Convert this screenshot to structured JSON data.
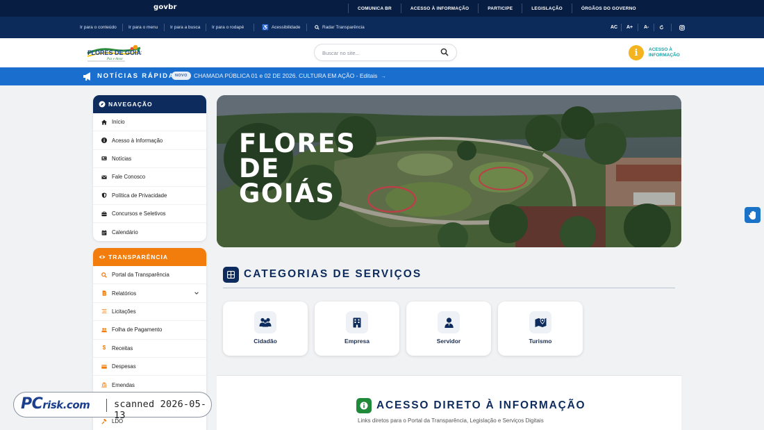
{
  "govbar": {
    "logo": "govbr",
    "links": [
      "COMUNICA BR",
      "ACESSO À INFORMAÇÃO",
      "PARTICIPE",
      "LEGISLAÇÃO",
      "ÓRGÃOS DO GOVERNO"
    ]
  },
  "accessibility": {
    "skip_content": "Ir para o conteúdo",
    "skip_menu": "Ir para o menu",
    "skip_search": "Ir para a busca",
    "skip_footer": "Ir para o rodapé",
    "accessibility": "Acessibilidade",
    "radar": "Radar Transparência",
    "contrast": "AC",
    "font_increase": "A+",
    "font_decrease": "A-",
    "reset_icon": "reset-icon",
    "instagram_icon": "instagram-icon"
  },
  "header": {
    "logo_text": "FLORES DE GOIÁS - GO",
    "logo_tagline": "Paz e Amor",
    "search_placeholder": "Buscar no site...",
    "acesso_label_1": "ACESSO À",
    "acesso_label_2": "INFORMAÇÃO",
    "acesso_badge": "i"
  },
  "newsbar": {
    "label": "NOTÍCIAS RÁPIDAS",
    "separator": "-",
    "badge": "NOVO",
    "headline": "CHAMADA PÚBLICA 01 e 02 DE 2026. CULTURA EM AÇÃO - Editais",
    "arrow": "→"
  },
  "sidebar": {
    "nav_title": "NAVEGAÇÃO",
    "nav_items": [
      {
        "label": "Início",
        "icon": "home-icon"
      },
      {
        "label": "Acesso à Informação",
        "icon": "info-icon"
      },
      {
        "label": "Notícias",
        "icon": "newspaper-icon"
      },
      {
        "label": "Fale Conosco",
        "icon": "envelope-icon"
      },
      {
        "label": "Política de Privacidade",
        "icon": "shield-icon"
      },
      {
        "label": "Concursos e Seletivos",
        "icon": "briefcase-icon"
      },
      {
        "label": "Calendário",
        "icon": "calendar-icon"
      }
    ],
    "transp_title": "TRANSPARÊNCIA",
    "transp_items": [
      {
        "label": "Portal da Transparência",
        "icon": "search-icon"
      },
      {
        "label": "Relatórios",
        "icon": "document-icon"
      },
      {
        "label": "Licitações",
        "icon": "list-icon"
      },
      {
        "label": "Folha de Pagamento",
        "icon": "users-icon"
      },
      {
        "label": "Receitas",
        "icon": "dollar-icon"
      },
      {
        "label": "Despesas",
        "icon": "card-icon"
      },
      {
        "label": "Emendas",
        "icon": "bank-icon"
      },
      {
        "label": "",
        "icon": "hidden"
      },
      {
        "label": "LDO",
        "icon": "gavel-icon"
      }
    ]
  },
  "hero": {
    "line1": "FLORES",
    "line2": "DE",
    "line3": "GOIÁS"
  },
  "categories": {
    "title": "CATEGORIAS DE SERVIÇOS",
    "cards": [
      {
        "label": "Cidadão",
        "icon": "citizens-icon"
      },
      {
        "label": "Empresa",
        "icon": "building-icon"
      },
      {
        "label": "Servidor",
        "icon": "employee-icon"
      },
      {
        "label": "Turismo",
        "icon": "map-icon"
      }
    ]
  },
  "direto": {
    "title": "ACESSO DIRETO À INFORMAÇÃO",
    "subtitle": "Links diretos para o Portal da Transparência, Legislação e Serviços Digitais"
  },
  "watermark": {
    "logo": "PC",
    "logo_suffix": "risk.com",
    "text": "scanned 2026-05-13"
  },
  "colors": {
    "gov_navy": "#071d41",
    "navy": "#0d2b5c",
    "news_blue": "#1a6fce",
    "orange": "#f27d0c",
    "info_yellow": "#f3b420",
    "teal": "#1aa2a8",
    "green": "#1e8a3a"
  }
}
